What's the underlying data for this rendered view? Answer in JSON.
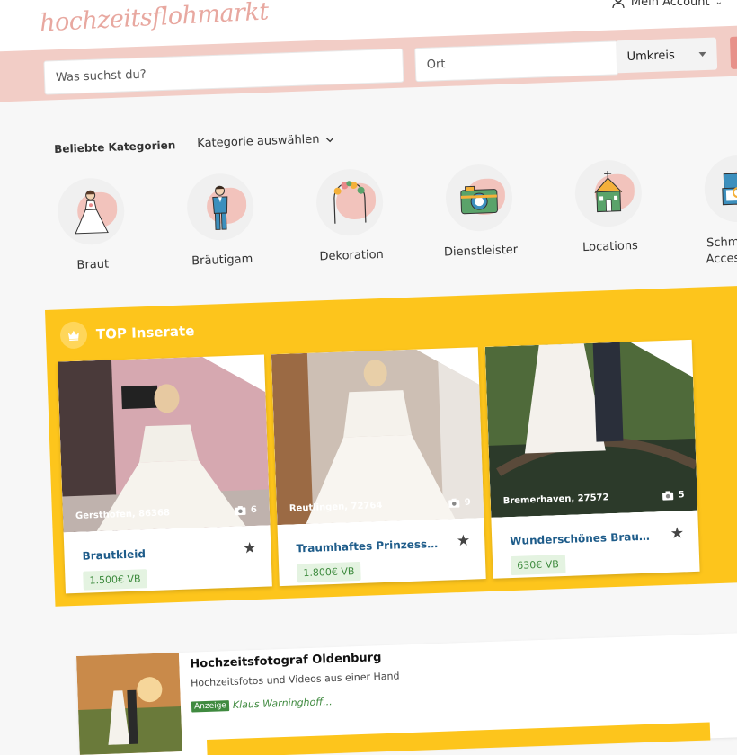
{
  "header": {
    "logo": "hochzeitsflohmarkt",
    "account_label": "Mein Account"
  },
  "search": {
    "query_placeholder": "Was suchst du?",
    "location_placeholder": "Ort",
    "radius_label": "Umkreis"
  },
  "categories": {
    "title": "Beliebte Kategorien",
    "select_label": "Kategorie auswählen",
    "items": [
      {
        "label": "Braut",
        "icon": "bride-icon"
      },
      {
        "label": "Bräutigam",
        "icon": "groom-icon"
      },
      {
        "label": "Dekoration",
        "icon": "flower-arch-icon"
      },
      {
        "label": "Dienstleister",
        "icon": "camera-icon"
      },
      {
        "label": "Locations",
        "icon": "chapel-icon"
      },
      {
        "label": "Schmuck & Accessoires",
        "icon": "ring-box-icon"
      }
    ]
  },
  "top": {
    "title": "TOP Inserate",
    "listings": [
      {
        "name": "Brautkleid",
        "location": "Gersthofen, 86368",
        "photos": "6",
        "price": "1.500€ VB"
      },
      {
        "name": "Traumhaftes Prinzessinnenkleid",
        "location": "Reutlingen, 72764",
        "photos": "9",
        "price": "1.800€ VB"
      },
      {
        "name": "Wunderschönes Brautkleid",
        "location": "Bremerhaven, 27572",
        "photos": "5",
        "price": "630€ VB"
      }
    ]
  },
  "ad": {
    "title": "Hochzeitsfotograf Oldenburg",
    "subtitle": "Hochzeitsfotos und Videos aus einer Hand",
    "badge": "Anzeige",
    "author": "Klaus Warninghoff..."
  },
  "colors": {
    "brand_pink": "#f2cdc6",
    "accent_yellow": "#fdc51c",
    "link_blue": "#1e5c8a",
    "price_green": "#3c8a3c"
  }
}
